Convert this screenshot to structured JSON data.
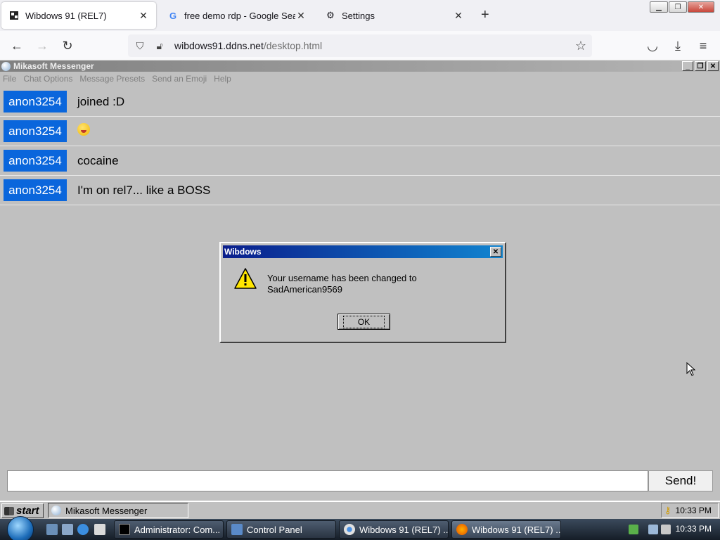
{
  "browser": {
    "tabs": [
      {
        "title": "Wibdows 91 (REL7)",
        "icon": "wibdows-favicon"
      },
      {
        "title": "free demo rdp - Google Search",
        "icon": "google-icon"
      },
      {
        "title": "Settings",
        "icon": "gear-icon"
      }
    ],
    "url_host": "wibdows91.ddns.net",
    "url_path": "/desktop.html"
  },
  "messenger": {
    "title": "Mikasoft Messenger",
    "menu": [
      "File",
      "Chat Options",
      "Message Presets",
      "Send an Emoji",
      "Help"
    ],
    "messages": [
      {
        "user": "anon3254",
        "text": "joined :D"
      },
      {
        "user": "anon3254",
        "text": "",
        "emoji": "zany-face-emoji"
      },
      {
        "user": "anon3254",
        "text": "cocaine"
      },
      {
        "user": "anon3254",
        "text": "I'm on rel7... like a BOSS"
      }
    ],
    "input_value": "",
    "send_label": "Send!"
  },
  "dialog": {
    "title": "Wibdows",
    "message_line1": "Your username has been changed to",
    "message_line2": "SadAmerican9569",
    "ok_label": "OK",
    "icon": "warning-icon"
  },
  "inner_taskbar": {
    "start_label": "start",
    "task_label": "Mikasoft Messenger",
    "clock": "10:33 PM"
  },
  "os_taskbar": {
    "buttons": [
      "Administrator: Com...",
      "Control Panel",
      "Wibdows 91 (REL7) ...",
      "Wibdows 91 (REL7) ..."
    ],
    "clock": "10:33 PM"
  }
}
